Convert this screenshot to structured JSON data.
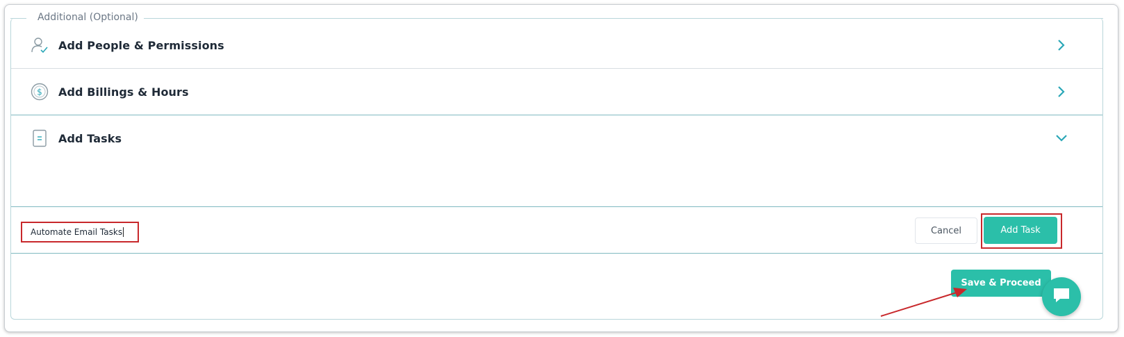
{
  "section": {
    "legend": "Additional (Optional)"
  },
  "rows": [
    {
      "label": "Add People & Permissions",
      "icon": "person-check-icon",
      "state": "collapsed"
    },
    {
      "label": "Add Billings & Hours",
      "icon": "dollar-circle-icon",
      "state": "collapsed"
    },
    {
      "label": "Add Tasks",
      "icon": "document-icon",
      "state": "expanded"
    }
  ],
  "task_form": {
    "input_value": "Automate Email Tasks",
    "cancel_label": "Cancel",
    "add_label": "Add Task"
  },
  "footer": {
    "save_label": "Save & Proceed"
  },
  "chat": {
    "icon": "chat-bubble-icon"
  },
  "colors": {
    "accent": "#2bbfa9",
    "highlight": "#c8282b",
    "chevron": "#2aa7b7"
  }
}
